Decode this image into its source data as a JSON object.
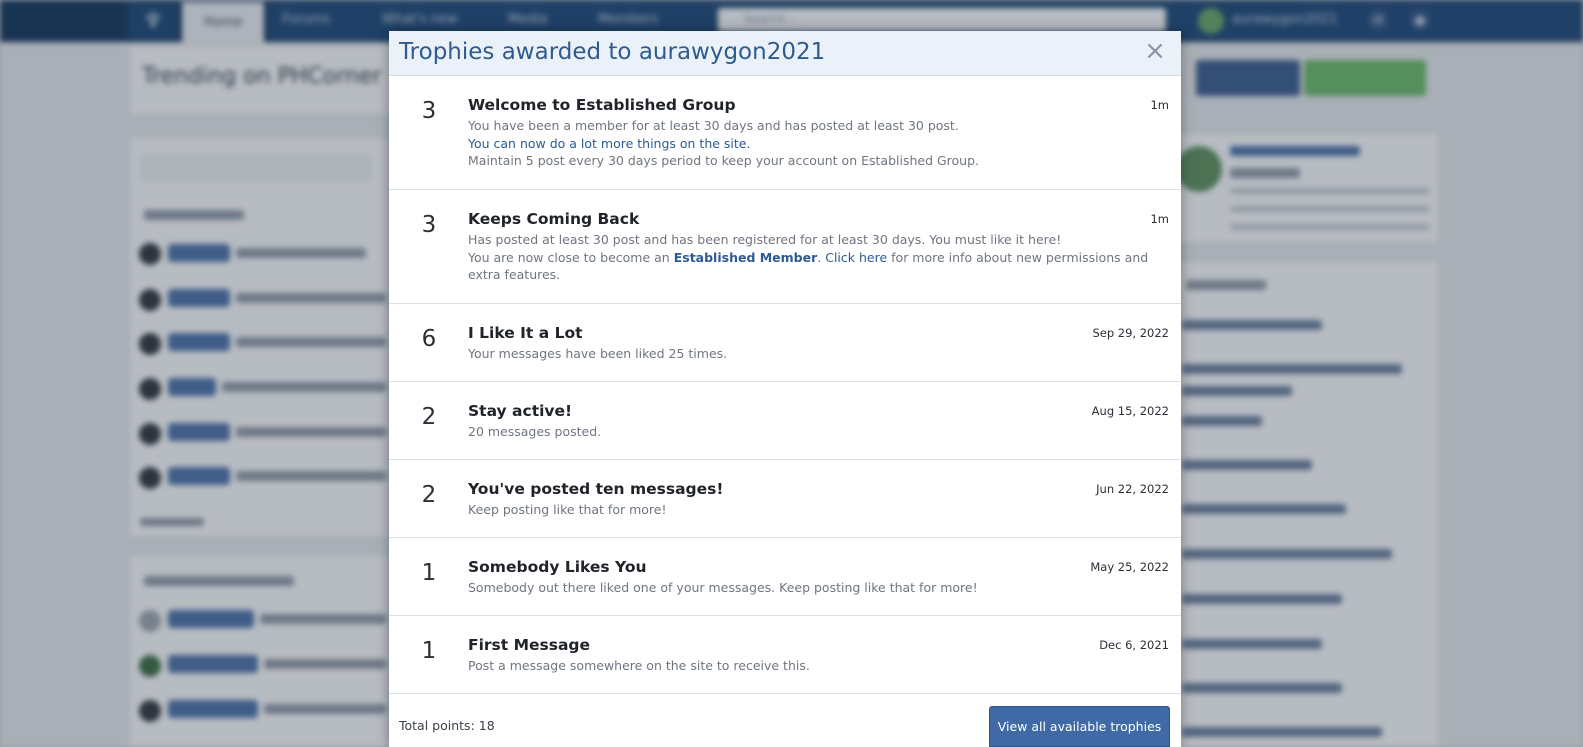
{
  "background": {
    "nav": {
      "logo_glyph": "♆",
      "home_tab": "Home",
      "items": [
        "Forums",
        "What's new",
        "Media",
        "Members"
      ],
      "search_placeholder": "Search...",
      "username": "aurawygon2021",
      "icons": [
        "mail-icon",
        "bell-icon"
      ]
    },
    "trending_title": "Trending on PHCorner"
  },
  "modal": {
    "title": "Trophies awarded to aurawygon2021",
    "close_glyph": "×",
    "trophies": [
      {
        "points": "3",
        "title": "Welcome to Established Group",
        "date": "1m",
        "line1": "You have been a member for at least 30 days and has posted at least 30 post.",
        "line2": "You can now do a lot more things on the site.",
        "line3": "Maintain 5 post every 30 days period to keep your account on Established Group."
      },
      {
        "points": "3",
        "title": "Keeps Coming Back",
        "date": "1m",
        "line1": "Has posted at least 30 post and has been registered for at least 30 days. You must like it here!",
        "line2_pre": "You are now close to become an ",
        "line2_link1": "Established Member",
        "line2_mid": ". ",
        "line2_link2": "Click here",
        "line2_post": " for more info about new permissions and extra features."
      },
      {
        "points": "6",
        "title": "I Like It a Lot",
        "date": "Sep 29, 2022",
        "desc": "Your messages have been liked 25 times."
      },
      {
        "points": "2",
        "title": "Stay active!",
        "date": "Aug 15, 2022",
        "desc": "20 messages posted."
      },
      {
        "points": "2",
        "title": "You've posted ten messages!",
        "date": "Jun 22, 2022",
        "desc": "Keep posting like that for more!"
      },
      {
        "points": "1",
        "title": "Somebody Likes You",
        "date": "May 25, 2022",
        "desc": "Somebody out there liked one of your messages. Keep posting like that for more!"
      },
      {
        "points": "1",
        "title": "First Message",
        "date": "Dec 6, 2021",
        "desc": "Post a message somewhere on the site to receive this."
      }
    ],
    "footer": {
      "total_points": "Total points: 18",
      "view_all_label": "View all available trophies"
    }
  },
  "colors": {
    "header_bg": "#eaf1f9",
    "title_blue": "#2f5b8e",
    "button_blue": "#3f6aa6",
    "topbar": "#18385f"
  }
}
